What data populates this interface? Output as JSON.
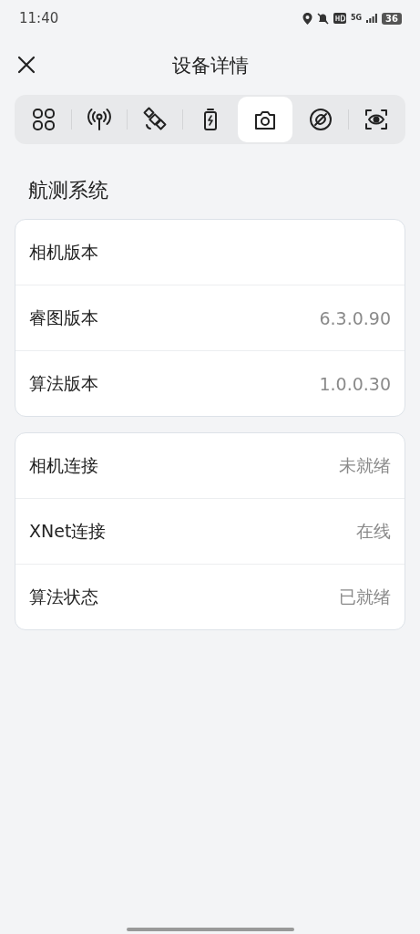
{
  "status_bar": {
    "time": "11:40",
    "network": "5G",
    "battery": "36"
  },
  "header": {
    "title": "设备详情"
  },
  "tabs": [
    {
      "kind": "grid",
      "selected": false
    },
    {
      "kind": "antenna",
      "selected": false
    },
    {
      "kind": "satellite",
      "selected": false
    },
    {
      "kind": "battery",
      "selected": false
    },
    {
      "kind": "camera",
      "selected": true
    },
    {
      "kind": "propeller",
      "selected": false
    },
    {
      "kind": "eye",
      "selected": false
    }
  ],
  "section_title": "航测系统",
  "cards": [
    {
      "rows": [
        {
          "label": "相机版本"
        },
        {
          "label": "睿图版本",
          "value": "6.3.0.90"
        },
        {
          "label": "算法版本",
          "value": "1.0.0.30"
        }
      ]
    },
    {
      "rows": [
        {
          "label": "相机连接",
          "value": "未就绪"
        },
        {
          "label": "XNet连接",
          "value": "在线"
        },
        {
          "label": "算法状态",
          "value": "已就绪"
        }
      ]
    }
  ]
}
